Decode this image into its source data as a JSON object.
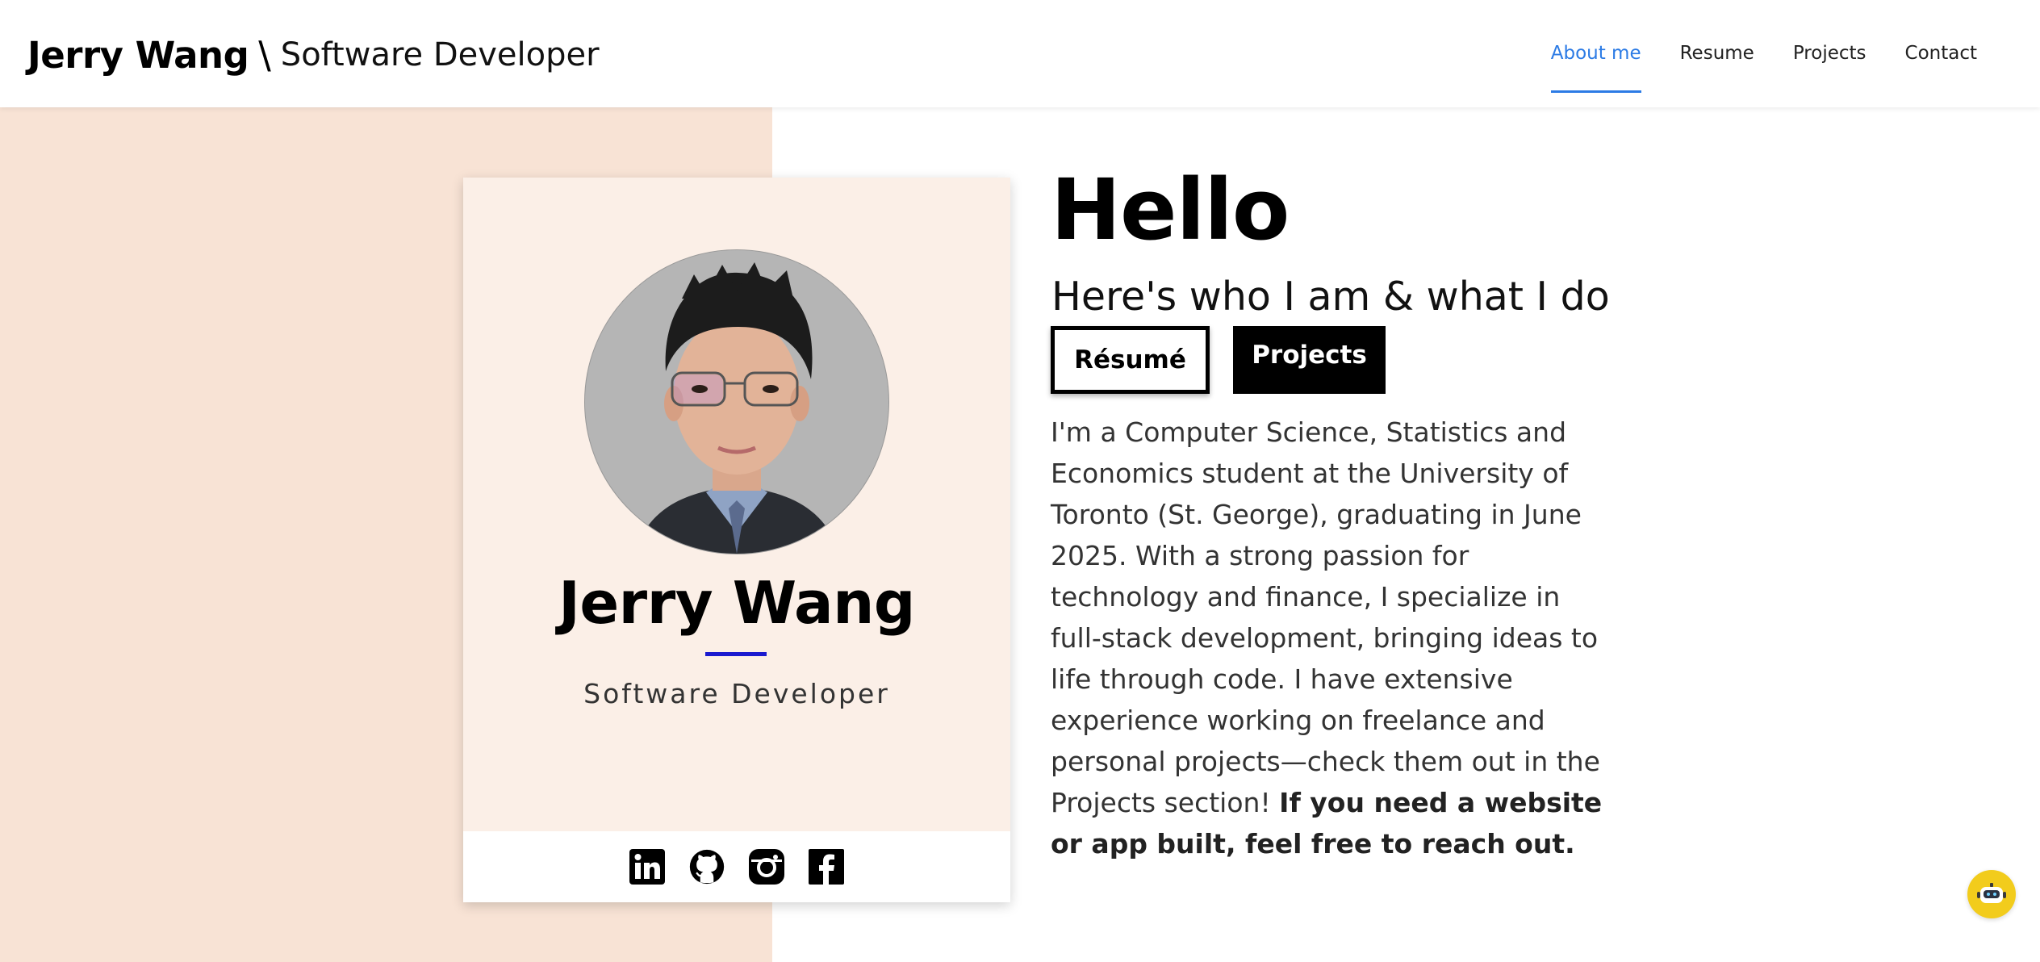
{
  "header": {
    "brand_name": "Jerry Wang",
    "brand_separator": "\\",
    "brand_role": "Software Developer",
    "nav": [
      {
        "label": "About me",
        "active": true
      },
      {
        "label": "Resume",
        "active": false
      },
      {
        "label": "Projects",
        "active": false
      },
      {
        "label": "Contact",
        "active": false
      }
    ],
    "accent_color": "#2c7be5"
  },
  "profile_card": {
    "name": "Jerry Wang",
    "role": "Software Developer",
    "divider_color": "#1a1acf",
    "social_icons": [
      "linkedin-icon",
      "github-icon",
      "instagram-icon",
      "facebook-icon"
    ]
  },
  "main": {
    "heading": "Hello",
    "subtitle": "Here's who I am & what I do",
    "buttons": {
      "resume": "Résumé",
      "projects": "Projects"
    },
    "bio_text": "I'm a Computer Science, Statistics and Economics student at the University of Toronto (St. George), graduating in June 2025. With a strong passion for technology and finance, I specialize in full-stack development, bringing ideas to life through code. I have extensive experience working on freelance and personal projects—check them out in the Projects section! ",
    "bio_bold": "If you need a website or app built, feel free to reach out."
  },
  "colors": {
    "peach_band": "#f8e3d5",
    "card_bg": "#fbefe7",
    "chat_button": "#f2cc1c"
  }
}
